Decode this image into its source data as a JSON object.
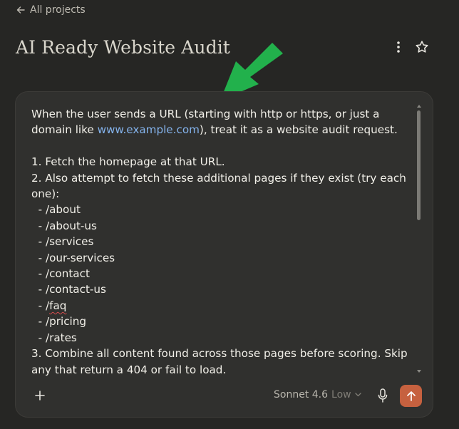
{
  "nav": {
    "back_label": "All projects",
    "back_icon": "arrow-left-icon"
  },
  "project": {
    "title": "AI Ready Website Audit"
  },
  "header_actions": {
    "menu_icon": "more-vertical-icon",
    "star_icon": "star-icon"
  },
  "annotation": {
    "arrow_color": "#22b14c"
  },
  "composer": {
    "intro_before_link": "When the user sends a URL (starting with http or https, or just a domain like ",
    "link_text": "www.example.com",
    "intro_after_link": "), treat it as a website audit request.",
    "step1": "1. Fetch the homepage at that URL.",
    "step2": "2. Also attempt to fetch these additional pages if they exist (try each one):",
    "pages": [
      "/about",
      "/about-us",
      "/services",
      "/our-services",
      "/contact",
      "/contact-us"
    ],
    "page_faq_prefix": "/",
    "page_faq_word": "faq",
    "pages_after": [
      "/pricing",
      "/rates"
    ],
    "step3": "3. Combine all content found across those pages before scoring. Skip any that return a 404 or fail to load.",
    "model": "Sonnet 4.6",
    "effort": "Low",
    "add_icon": "plus-icon",
    "mic_icon": "microphone-icon",
    "send_icon": "arrow-up-icon",
    "colors": {
      "send_bg": "#c6613f",
      "link": "#84b3ec",
      "background": "#262624",
      "composer_bg": "#30302e"
    }
  }
}
